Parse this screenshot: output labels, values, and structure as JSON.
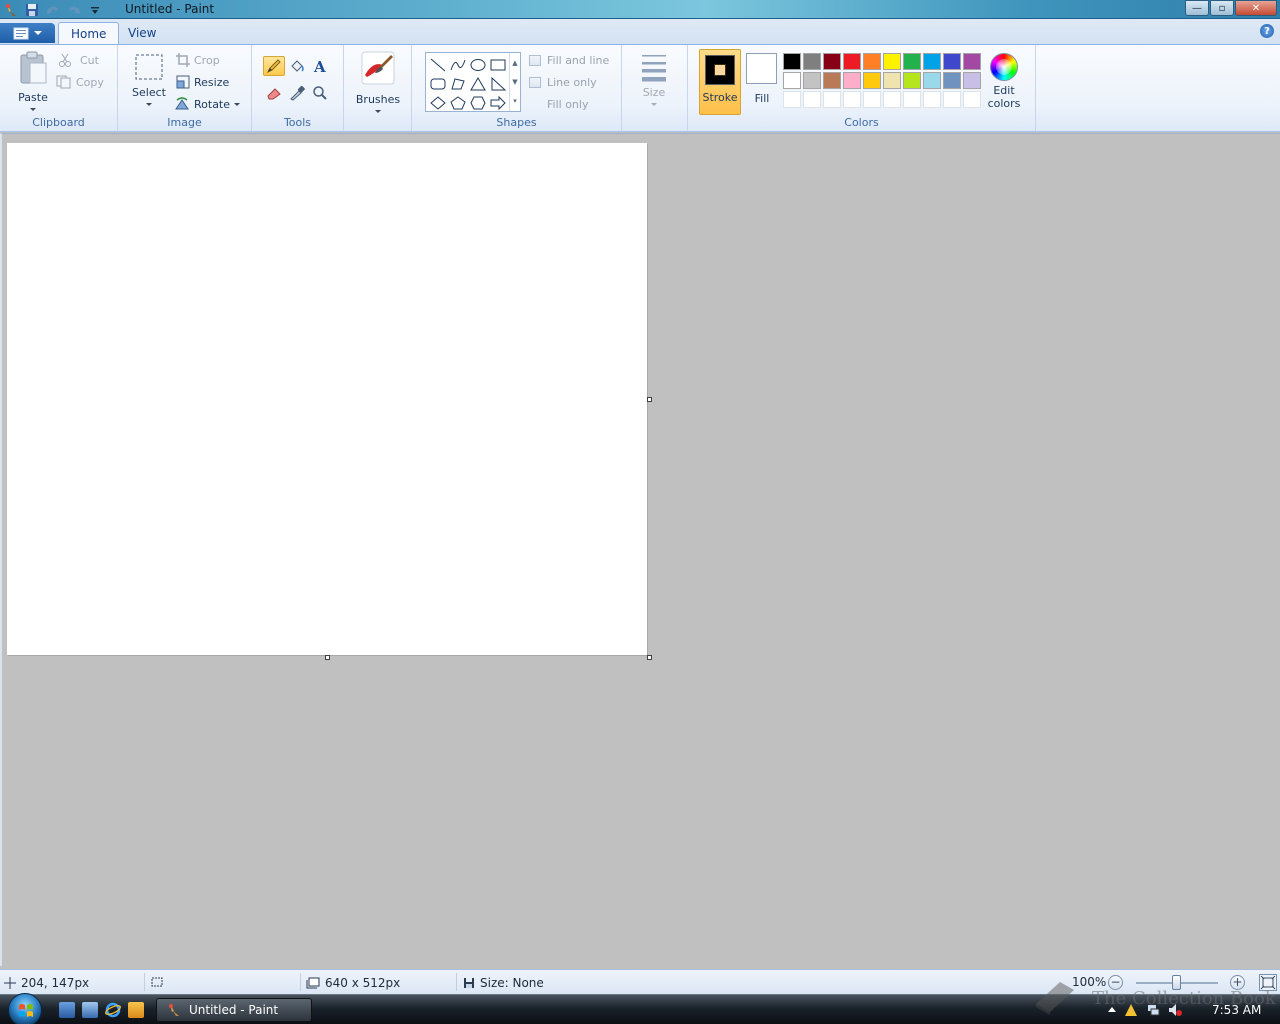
{
  "window": {
    "title": "Untitled - Paint",
    "min_glyph": "—",
    "max_glyph": "▫",
    "close_glyph": "✕"
  },
  "tabs": {
    "home": "Home",
    "view": "View"
  },
  "help_glyph": "?",
  "clipboard": {
    "paste": "Paste",
    "cut": "Cut",
    "copy": "Copy",
    "label": "Clipboard"
  },
  "image": {
    "select": "Select",
    "crop": "Crop",
    "resize": "Resize",
    "rotate": "Rotate",
    "label": "Image"
  },
  "tools": {
    "label": "Tools",
    "items": [
      "pencil",
      "fill-bucket",
      "text",
      "eraser",
      "color-picker",
      "magnifier"
    ],
    "active": "pencil"
  },
  "brushes": {
    "label": "Brushes"
  },
  "shapes": {
    "label": "Shapes",
    "items": [
      "line",
      "curve",
      "oval",
      "rectangle",
      "rounded-rectangle",
      "polygon",
      "triangle",
      "right-triangle",
      "diamond",
      "pentagon",
      "hexagon",
      "right-arrow"
    ],
    "outline_options": [
      "Fill and line",
      "Line only",
      "Fill only"
    ]
  },
  "size": {
    "label": "Size"
  },
  "colors": {
    "label": "Colors",
    "stroke": "Stroke",
    "fill": "Fill",
    "edit_line1": "Edit",
    "edit_line2": "colors",
    "stroke_color": "#000000",
    "fill_color": "#ffffff",
    "row1": [
      "#000000",
      "#7f7f7f",
      "#880015",
      "#ed1c24",
      "#ff7f27",
      "#fff200",
      "#22b14c",
      "#00a2e8",
      "#3f48cc",
      "#a349a4"
    ],
    "row2": [
      "#ffffff",
      "#c3c3c3",
      "#b97a57",
      "#ffaec9",
      "#ffc90e",
      "#efe4b0",
      "#b5e61d",
      "#99d9ea",
      "#7092be",
      "#c8bfe7"
    ],
    "row3_empty": 10
  },
  "status": {
    "cursor_pos": "204, 147px",
    "selection_size": "",
    "canvas_size": "640 x 512px",
    "file_size": "Size: None",
    "zoom": "100%",
    "zoom_out": "−",
    "zoom_in": "+"
  },
  "taskbar": {
    "task_label": "Untitled - Paint",
    "clock": "7:53 AM"
  },
  "watermark": "The Collection Book"
}
